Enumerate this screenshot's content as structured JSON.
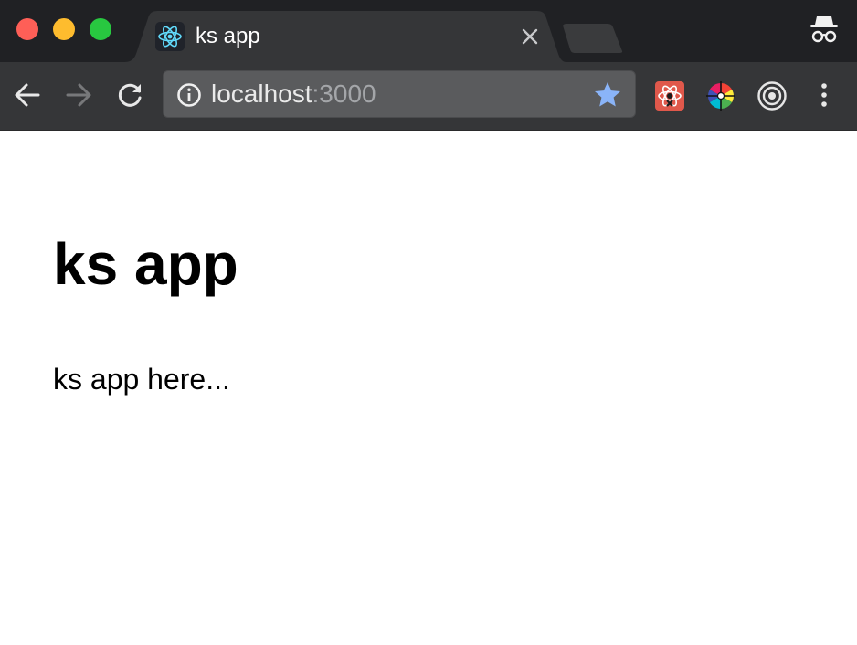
{
  "browser": {
    "tab": {
      "title": "ks app",
      "favicon": "react-icon",
      "close_icon": "close-icon"
    },
    "new_tab_icon": "new-tab-icon",
    "profile_icon": "incognito-icon",
    "toolbar": {
      "back_icon": "arrow-left-icon",
      "forward_icon": "arrow-right-icon",
      "reload_icon": "reload-icon",
      "menu_icon": "kebab-menu-icon"
    },
    "omnibox": {
      "info_icon": "info-icon",
      "url_host": "localhost",
      "url_port": ":3000",
      "star_icon": "star-icon"
    },
    "extensions": [
      "react-devtools-icon",
      "color-picker-icon",
      "target-icon"
    ]
  },
  "page": {
    "heading": "ks app",
    "body_text": "ks app here..."
  },
  "colors": {
    "tabstrip_bg": "#202124",
    "active_tab_bg": "#353638",
    "accent_star": "#8ab4f8",
    "react_blue": "#61dafb"
  }
}
